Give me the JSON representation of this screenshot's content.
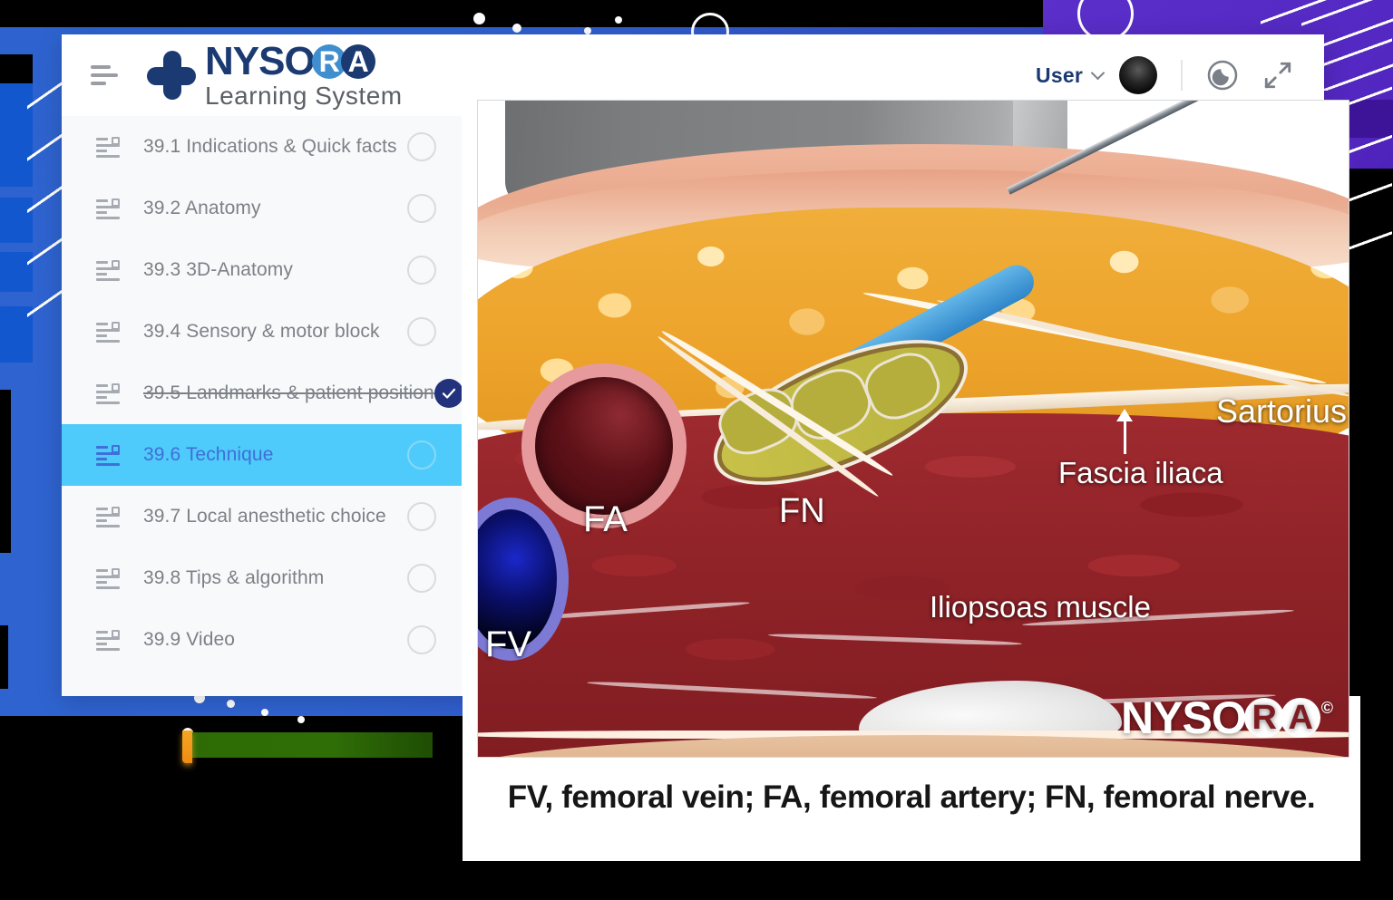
{
  "header": {
    "menu_icon": "hamburger-icon",
    "brand_top": "NYSO",
    "brand_r": "R",
    "brand_a": "A",
    "brand_sub": "Learning System",
    "user_label": "User",
    "chevron_icon": "chevron-down-icon",
    "avatar_icon": "user-avatar",
    "dark_mode_icon": "moon-icon",
    "fullscreen_icon": "expand-icon"
  },
  "sidebar": {
    "items": [
      {
        "label": "39.1 Indications & Quick facts",
        "state": "pending"
      },
      {
        "label": "39.2 Anatomy",
        "state": "pending"
      },
      {
        "label": "39.3 3D-Anatomy",
        "state": "pending"
      },
      {
        "label": "39.4 Sensory & motor block",
        "state": "pending"
      },
      {
        "label": "39.5 Landmarks & patient position",
        "state": "completed"
      },
      {
        "label": "39.6 Technique",
        "state": "active"
      },
      {
        "label": "39.7 Local anesthetic choice",
        "state": "pending"
      },
      {
        "label": "39.8 Tips & algorithm",
        "state": "pending"
      },
      {
        "label": "39.9 Video",
        "state": "pending"
      }
    ]
  },
  "figure": {
    "labels": {
      "fv": "FV",
      "fa": "FA",
      "fn": "FN",
      "sartorius": "Sartorius",
      "fascia_iliaca": "Fascia iliaca",
      "iliopsoas": "Iliopsoas muscle"
    },
    "watermark": {
      "part1": "NYSO",
      "part2": "R",
      "part3": "A",
      "copyright": "©"
    },
    "caption": "FV, femoral vein; FA, femoral artery; FN, femoral nerve."
  },
  "colors": {
    "brand_navy": "#1b3a72",
    "active_row": "#4ecbfa",
    "active_text": "#3f6fd8",
    "check_circle": "#22327d",
    "bg_blue": "#2e63cf",
    "bg_purple": "#5b2fc9",
    "accent_green": "#2e6b06",
    "accent_orange": "#f5a623"
  }
}
